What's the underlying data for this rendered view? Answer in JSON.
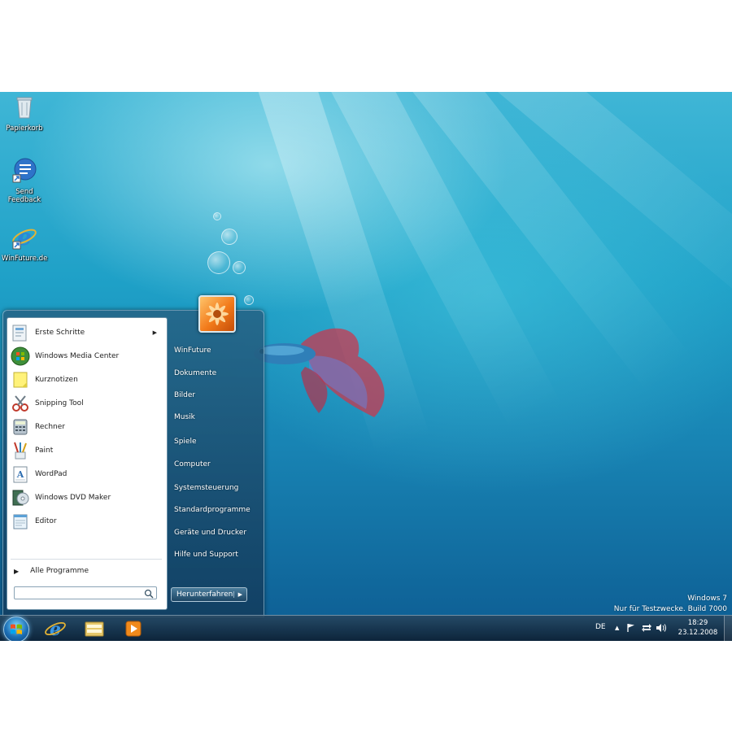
{
  "desktop": {
    "icons": [
      {
        "label": "Papierkorb"
      },
      {
        "label": "Send Feedback"
      },
      {
        "label": "WinFuture.de"
      }
    ]
  },
  "start_menu": {
    "programs": [
      {
        "label": "Erste Schritte",
        "has_submenu": true
      },
      {
        "label": "Windows Media Center"
      },
      {
        "label": "Kurznotizen"
      },
      {
        "label": "Snipping Tool"
      },
      {
        "label": "Rechner"
      },
      {
        "label": "Paint"
      },
      {
        "label": "WordPad"
      },
      {
        "label": "Windows DVD Maker"
      },
      {
        "label": "Editor"
      }
    ],
    "all_programs": "Alle Programme",
    "search_placeholder": "",
    "right_links": [
      {
        "label": "WinFuture"
      },
      {
        "label": "Dokumente"
      },
      {
        "label": "Bilder"
      },
      {
        "label": "Musik"
      },
      {
        "label": "Spiele"
      },
      {
        "label": "Computer"
      },
      {
        "label": "Systemsteuerung"
      },
      {
        "label": "Standardprogramme"
      },
      {
        "label": "Geräte und Drucker"
      },
      {
        "label": "Hilfe und Support"
      }
    ],
    "shutdown_label": "Herunterfahren"
  },
  "taskbar": {
    "pinned": [
      {
        "name": "internet-explorer",
        "icon": "ie-icon"
      },
      {
        "name": "explorer",
        "icon": "folder-icon"
      },
      {
        "name": "media-player",
        "icon": "media-player-icon"
      }
    ],
    "tray": {
      "language": "DE",
      "time": "18:29",
      "date": "23.12.2008"
    }
  },
  "watermark": {
    "line1": "Windows 7",
    "line2": "Nur für Testzwecke. Build 7000"
  },
  "colors": {
    "accent": "#1ea0c7",
    "start_menu_bg": "#1f4f73",
    "taskbar_bg": "#16324a"
  }
}
